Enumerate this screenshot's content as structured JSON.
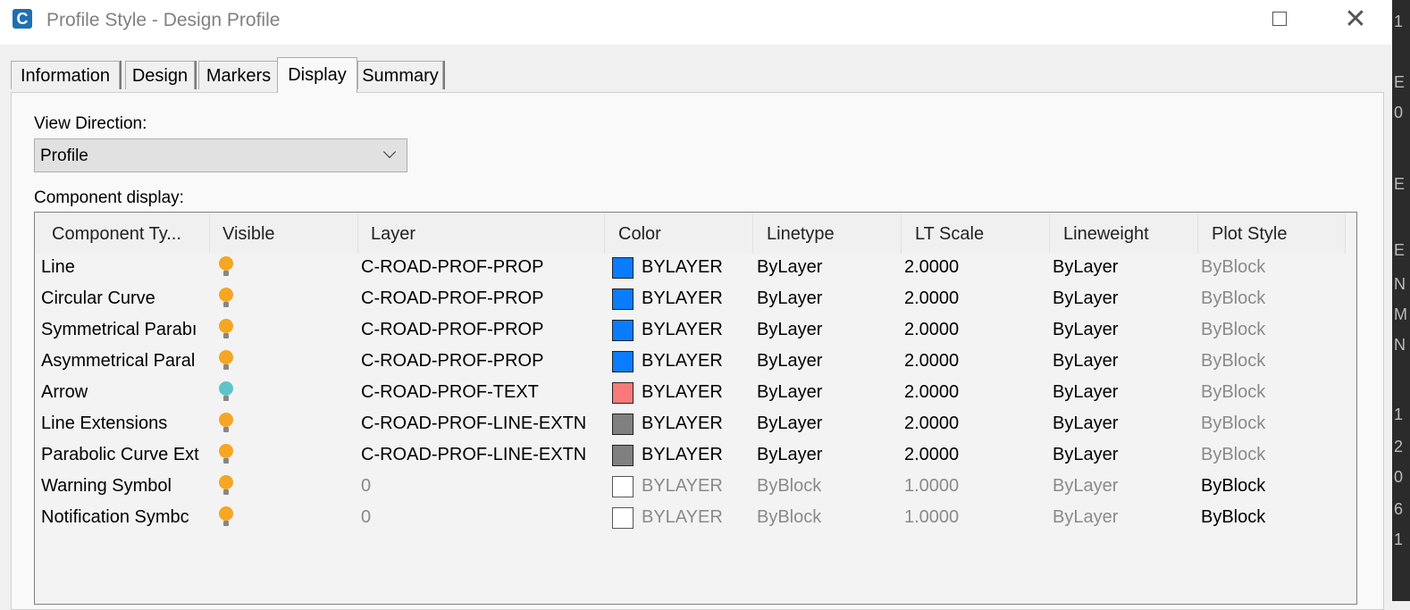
{
  "window": {
    "title": "Profile Style - Design Profile",
    "app_icon_letter": "C",
    "maximize_icon": "maximize-icon",
    "close_icon": "close-icon",
    "close_glyph": "✕"
  },
  "tabs": [
    {
      "label": "Information",
      "active": false
    },
    {
      "label": "Design",
      "active": false
    },
    {
      "label": "Markers",
      "active": false
    },
    {
      "label": "Display",
      "active": true
    },
    {
      "label": "Summary",
      "active": false
    }
  ],
  "view_direction": {
    "label": "View Direction:",
    "selected": "Profile"
  },
  "component_display": {
    "label": "Component display:",
    "columns": [
      "Component Ty...",
      "Visible",
      "Layer",
      "Color",
      "Linetype",
      "LT Scale",
      "Lineweight",
      "Plot Style"
    ],
    "rows": [
      {
        "component": "Line",
        "visible_color": "#f5a623",
        "layer": "C-ROAD-PROF-PROP",
        "swatch": "#0a7cff",
        "color": "BYLAYER",
        "linetype": "ByLayer",
        "lt_scale": "2.0000",
        "lineweight": "ByLayer",
        "plot_style": "ByBlock",
        "dim": false
      },
      {
        "component": "Circular Curve",
        "visible_color": "#f5a623",
        "layer": "C-ROAD-PROF-PROP",
        "swatch": "#0a7cff",
        "color": "BYLAYER",
        "linetype": "ByLayer",
        "lt_scale": "2.0000",
        "lineweight": "ByLayer",
        "plot_style": "ByBlock",
        "dim": false
      },
      {
        "component": "Symmetrical Parabı",
        "visible_color": "#f5a623",
        "layer": "C-ROAD-PROF-PROP",
        "swatch": "#0a7cff",
        "color": "BYLAYER",
        "linetype": "ByLayer",
        "lt_scale": "2.0000",
        "lineweight": "ByLayer",
        "plot_style": "ByBlock",
        "dim": false
      },
      {
        "component": "Asymmetrical Paral",
        "visible_color": "#f5a623",
        "layer": "C-ROAD-PROF-PROP",
        "swatch": "#0a7cff",
        "color": "BYLAYER",
        "linetype": "ByLayer",
        "lt_scale": "2.0000",
        "lineweight": "ByLayer",
        "plot_style": "ByBlock",
        "dim": false
      },
      {
        "component": "Arrow",
        "visible_color": "#5ec4c8",
        "layer": "C-ROAD-PROF-TEXT",
        "swatch": "#f87a7a",
        "color": "BYLAYER",
        "linetype": "ByLayer",
        "lt_scale": "2.0000",
        "lineweight": "ByLayer",
        "plot_style": "ByBlock",
        "dim": false
      },
      {
        "component": "Line Extensions",
        "visible_color": "#f5a623",
        "layer": "C-ROAD-PROF-LINE-EXTN",
        "swatch": "#808080",
        "color": "BYLAYER",
        "linetype": "ByLayer",
        "lt_scale": "2.0000",
        "lineweight": "ByLayer",
        "plot_style": "ByBlock",
        "dim": false
      },
      {
        "component": "Parabolic Curve Ext",
        "visible_color": "#f5a623",
        "layer": "C-ROAD-PROF-LINE-EXTN",
        "swatch": "#808080",
        "color": "BYLAYER",
        "linetype": "ByLayer",
        "lt_scale": "2.0000",
        "lineweight": "ByLayer",
        "plot_style": "ByBlock",
        "dim": false
      },
      {
        "component": "Warning Symbol",
        "visible_color": "#f5a623",
        "layer": "0",
        "swatch": "#ffffff",
        "color": "BYLAYER",
        "linetype": "ByBlock",
        "lt_scale": "1.0000",
        "lineweight": "ByLayer",
        "plot_style": "ByBlock",
        "dim": true
      },
      {
        "component": "Notification Symbc",
        "visible_color": "#f5a623",
        "layer": "0",
        "swatch": "#ffffff",
        "color": "BYLAYER",
        "linetype": "ByBlock",
        "lt_scale": "1.0000",
        "lineweight": "ByLayer",
        "plot_style": "ByBlock",
        "dim": true
      }
    ]
  },
  "background_strip": {
    "glyphs": [
      "1",
      "E",
      "0",
      "E",
      "E",
      "N",
      "M",
      "N",
      "1",
      "2",
      "0",
      "6",
      "1"
    ]
  }
}
